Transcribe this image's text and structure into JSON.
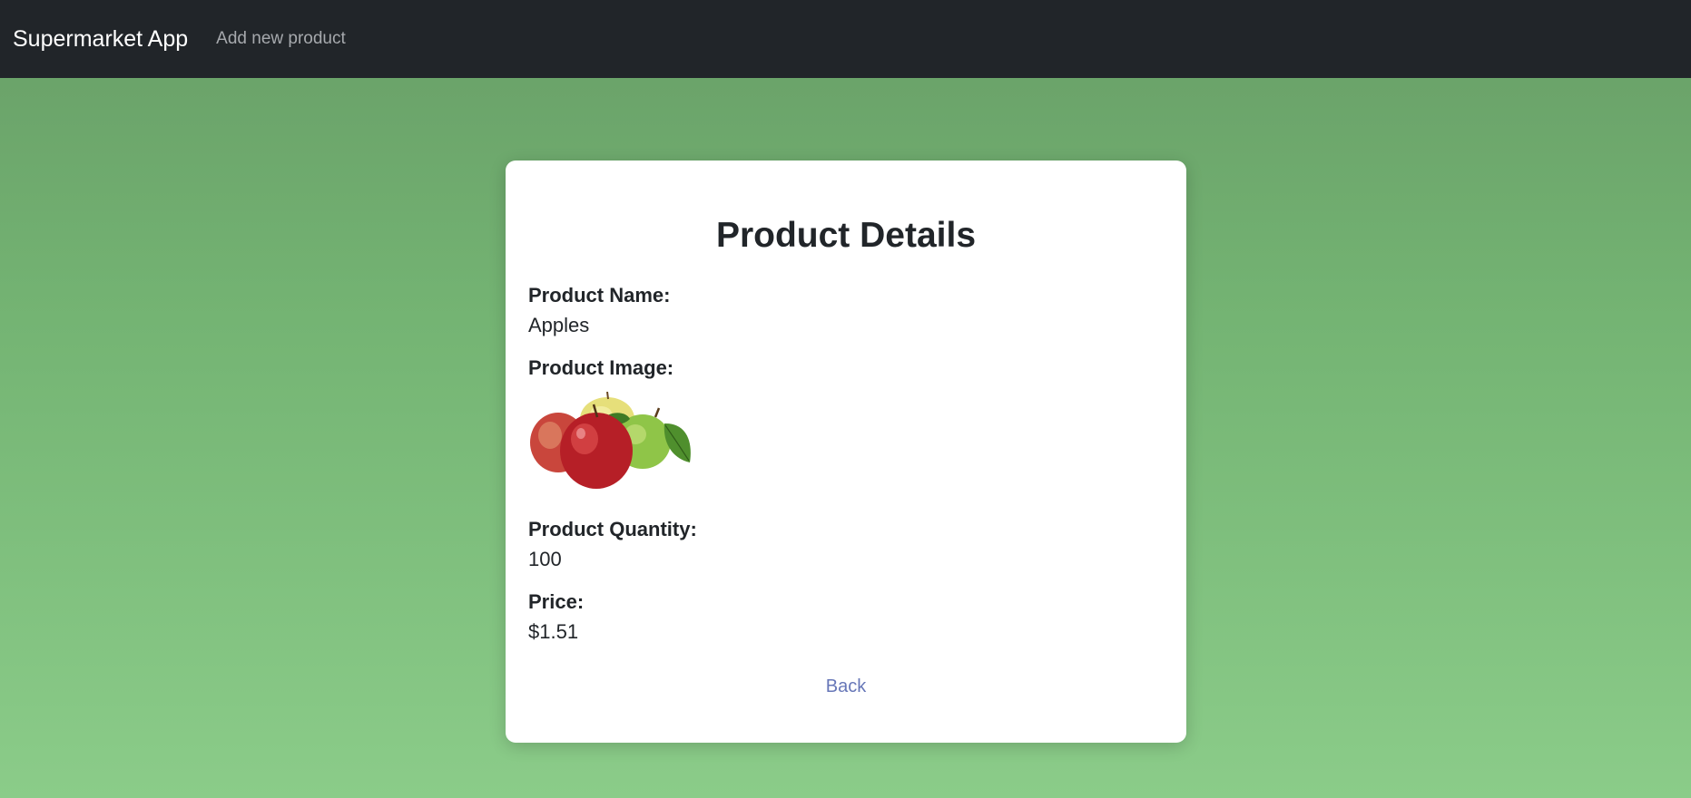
{
  "navbar": {
    "brand": "Supermarket App",
    "add_link": "Add new product"
  },
  "card": {
    "title": "Product Details",
    "fields": {
      "name_label": "Product Name:",
      "name_value": "Apples",
      "image_label": "Product Image:",
      "quantity_label": "Product Quantity:",
      "quantity_value": "100",
      "price_label": "Price:",
      "price_value": "$1.51"
    },
    "back_label": "Back"
  },
  "colors": {
    "navbar_bg": "#212529",
    "background_top": "#689e67",
    "background_bottom": "#8bcc89",
    "card_bg": "#ffffff",
    "link": "#6777b8"
  },
  "icons": {
    "product_image": "apples-image"
  }
}
